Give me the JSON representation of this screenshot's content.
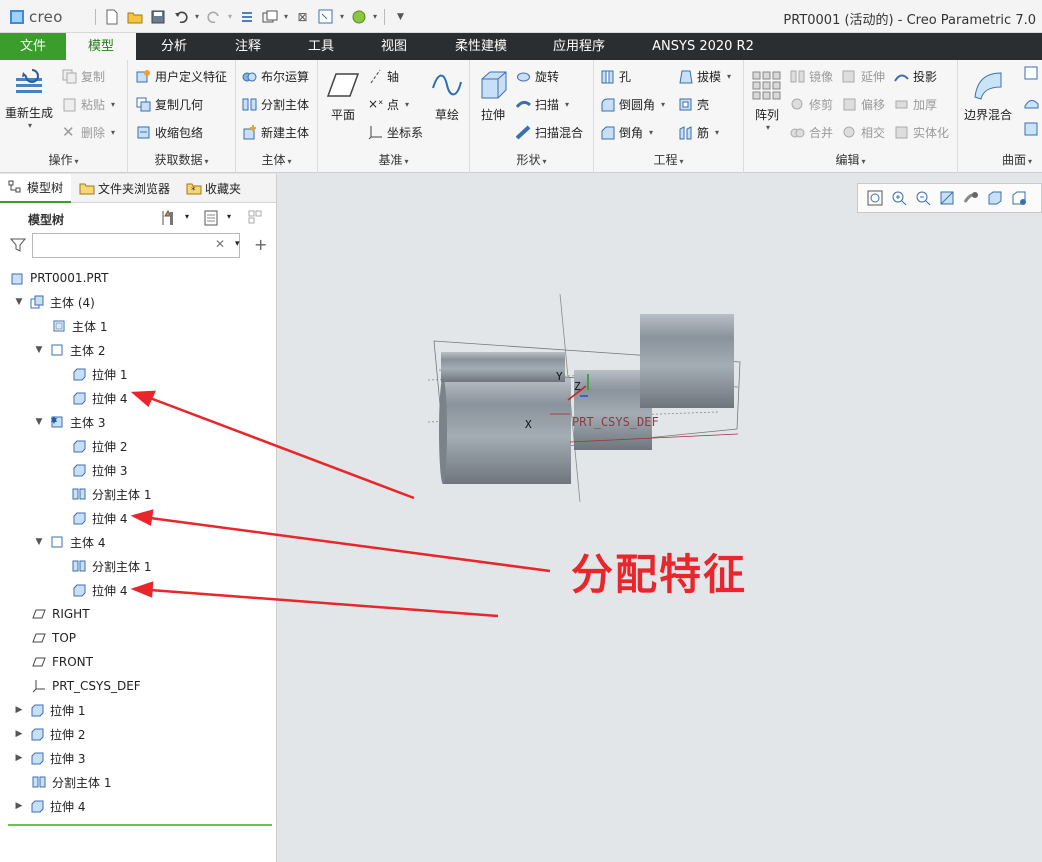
{
  "app": {
    "logo": "creo",
    "window_title": "PRT0001 (活动的) - Creo Parametric 7.0"
  },
  "ribbon_tabs": [
    "文件",
    "模型",
    "分析",
    "注释",
    "工具",
    "视图",
    "柔性建模",
    "应用程序",
    "ANSYS 2020 R2"
  ],
  "ribbon": {
    "operations": {
      "regen": "重新生成",
      "copy": "复制",
      "paste": "粘贴",
      "delete": "删除",
      "label": "操作"
    },
    "get_data": {
      "udf": "用户定义特征",
      "copy_geom": "复制几何",
      "shrinkwrap": "收缩包络",
      "label": "获取数据"
    },
    "body": {
      "boolean": "布尔运算",
      "split": "分割主体",
      "new": "新建主体",
      "label": "主体"
    },
    "datum": {
      "plane": "平面",
      "axis": "轴",
      "point": "点",
      "csys": "坐标系",
      "sketch": "草绘",
      "label": "基准"
    },
    "shapes": {
      "extrude": "拉伸",
      "revolve": "旋转",
      "sweep": "扫描",
      "swept_blend": "扫描混合",
      "label": "形状"
    },
    "engineering": {
      "hole": "孔",
      "round": "倒圆角",
      "chamfer": "倒角",
      "draft": "拔模",
      "shell": "壳",
      "rib": "筋",
      "label": "工程"
    },
    "editing": {
      "pattern": "阵列",
      "mirror": "镜像",
      "trim": "修剪",
      "merge": "合并",
      "extend": "延伸",
      "offset": "偏移",
      "intersect": "相交",
      "project": "投影",
      "thicken": "加厚",
      "solidify": "实体化",
      "label": "编辑"
    },
    "surfaces": {
      "boundary_blend": "边界混合",
      "label": "曲面"
    }
  },
  "panel": {
    "tabs": [
      "模型树",
      "文件夹浏览器",
      "收藏夹"
    ],
    "header": "模型树",
    "search_placeholder": ""
  },
  "tree": [
    {
      "label": "PRT0001.PRT",
      "icon": "part-icon"
    },
    {
      "label": "主体 (4)",
      "icon": "bodies-icon"
    },
    {
      "label": "主体 1",
      "icon": "body-icon"
    },
    {
      "label": "主体 2",
      "icon": "body-icon"
    },
    {
      "label": "拉伸 1",
      "icon": "extrude-icon"
    },
    {
      "label": "拉伸 4",
      "icon": "extrude-icon"
    },
    {
      "label": "主体 3",
      "icon": "body-default-icon"
    },
    {
      "label": "拉伸 2",
      "icon": "extrude-icon"
    },
    {
      "label": "拉伸 3",
      "icon": "extrude-icon"
    },
    {
      "label": "分割主体 1",
      "icon": "split-body-icon"
    },
    {
      "label": "拉伸 4",
      "icon": "extrude-icon"
    },
    {
      "label": "主体 4",
      "icon": "body-icon"
    },
    {
      "label": "分割主体 1",
      "icon": "split-body-icon"
    },
    {
      "label": "拉伸 4",
      "icon": "extrude-icon"
    },
    {
      "label": "RIGHT",
      "icon": "datum-plane-icon"
    },
    {
      "label": "TOP",
      "icon": "datum-plane-icon"
    },
    {
      "label": "FRONT",
      "icon": "datum-plane-icon"
    },
    {
      "label": "PRT_CSYS_DEF",
      "icon": "csys-icon"
    },
    {
      "label": "拉伸 1",
      "icon": "extrude-icon"
    },
    {
      "label": "拉伸 2",
      "icon": "extrude-icon"
    },
    {
      "label": "拉伸 3",
      "icon": "extrude-icon"
    },
    {
      "label": "分割主体 1",
      "icon": "split-body-icon"
    },
    {
      "label": "拉伸 4",
      "icon": "extrude-icon"
    }
  ],
  "viewport": {
    "csys_label": "PRT_CSYS_DEF",
    "axis_x": "X",
    "axis_y": "Y",
    "axis_z": "Z",
    "annotation": "分配特征",
    "annotation_color": "#e8262b"
  },
  "colors": {
    "accent_green": "#3a9d2c",
    "tabbar": "#2b2e31"
  }
}
